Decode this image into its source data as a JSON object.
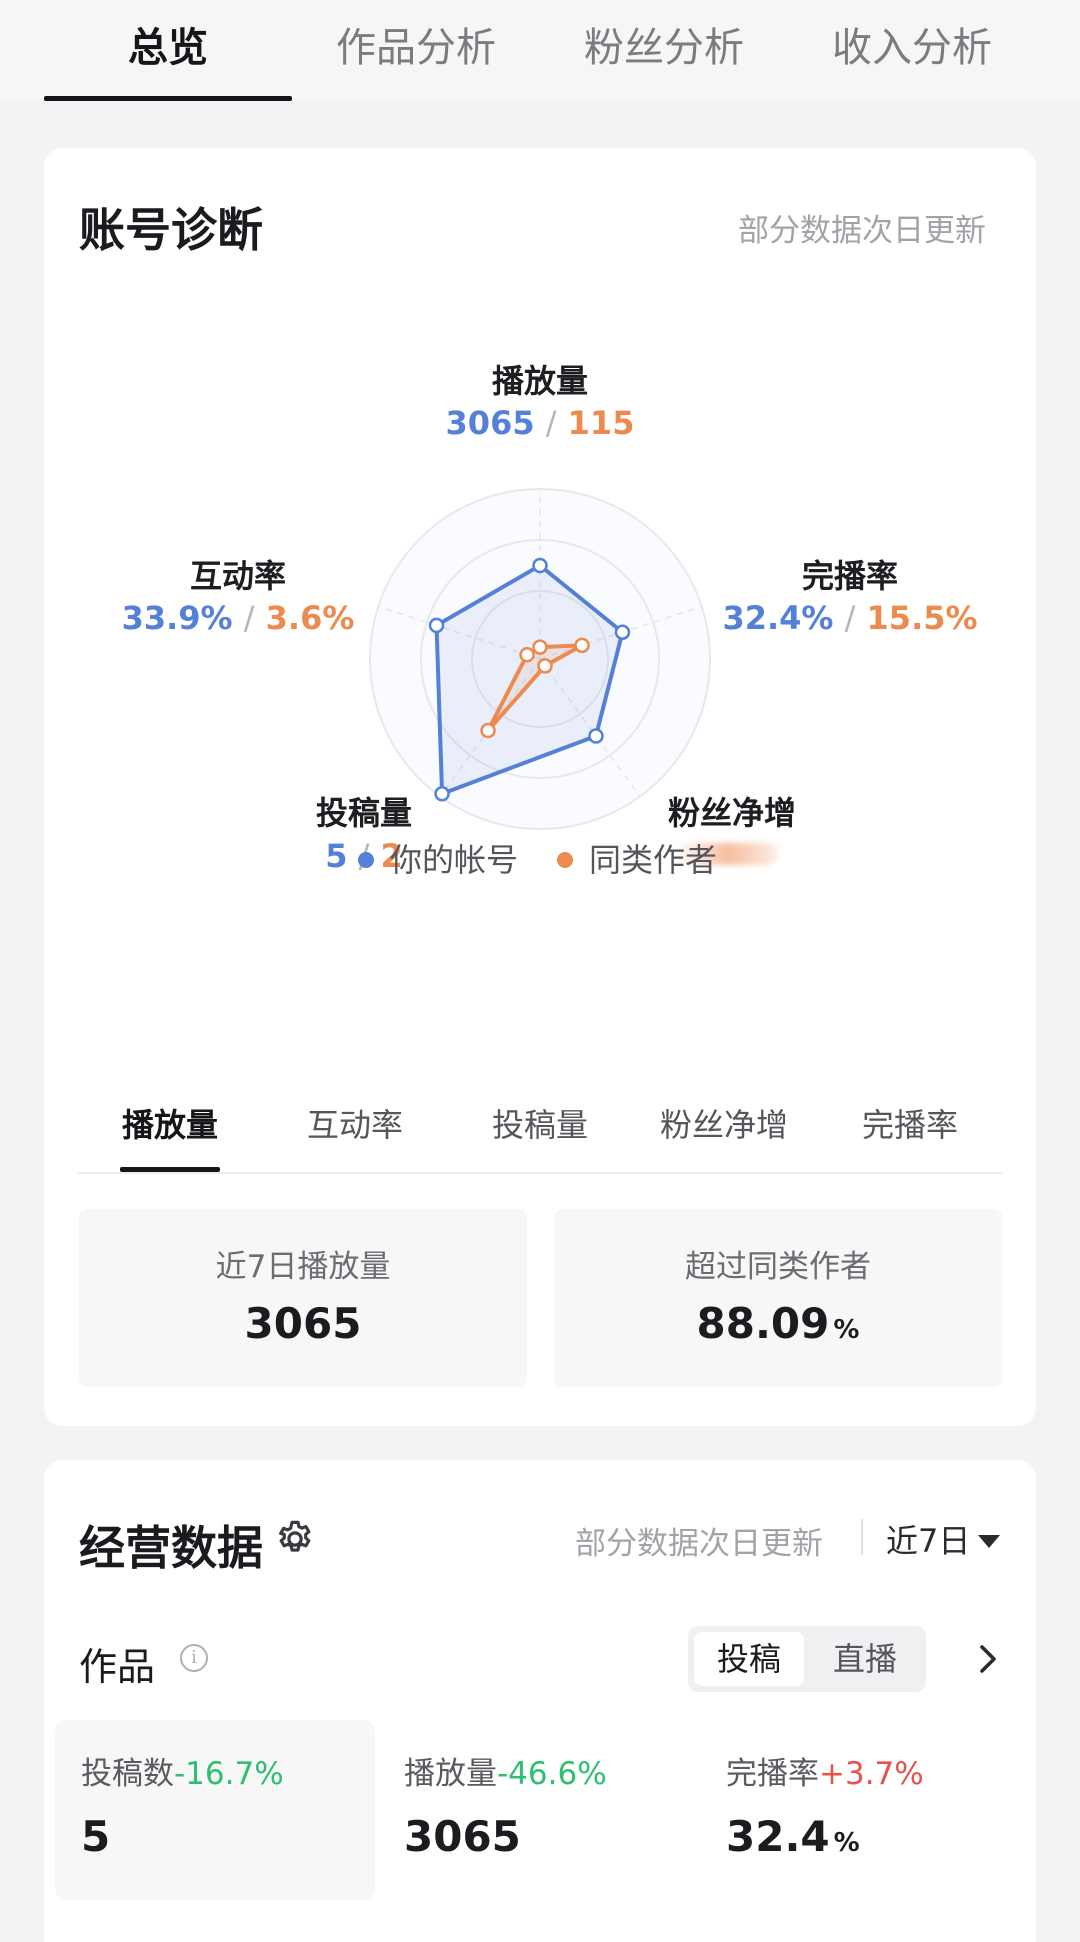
{
  "top_tabs": [
    {
      "label": "总览",
      "active": true
    },
    {
      "label": "作品分析",
      "active": false
    },
    {
      "label": "粉丝分析",
      "active": false
    },
    {
      "label": "收入分析",
      "active": false
    }
  ],
  "diagnosis": {
    "title": "账号诊断",
    "note": "部分数据次日更新",
    "colors": {
      "you": "#5480d8",
      "peer": "#ec8a4f"
    },
    "axes": [
      {
        "label": "播放量",
        "you": "3065",
        "peer": "115"
      },
      {
        "label": "完播率",
        "you": "32.4%",
        "peer": "15.5%"
      },
      {
        "label": "粉丝净增",
        "you": "",
        "peer": "",
        "blurred": true
      },
      {
        "label": "投稿量",
        "you": "5",
        "peer": "2"
      },
      {
        "label": "互动率",
        "you": "33.9%",
        "peer": "3.6%"
      }
    ],
    "separator": "/",
    "legend": [
      {
        "label": "你的帐号",
        "color": "#5480d8"
      },
      {
        "label": "同类作者",
        "color": "#ec8a4f"
      }
    ],
    "metric_tabs": [
      {
        "label": "播放量",
        "active": true
      },
      {
        "label": "互动率",
        "active": false
      },
      {
        "label": "投稿量",
        "active": false
      },
      {
        "label": "粉丝净增",
        "active": false
      },
      {
        "label": "完播率",
        "active": false
      }
    ],
    "stats": [
      {
        "label": "近7日播放量",
        "value": "3065",
        "unit": ""
      },
      {
        "label": "超过同类作者",
        "value": "88.09",
        "unit": "%"
      }
    ]
  },
  "business": {
    "title": "经营数据",
    "settings_icon": "gear-icon",
    "note": "部分数据次日更新",
    "range": "近7日",
    "section": {
      "title": "作品",
      "info_icon": "info-icon",
      "segments": [
        {
          "label": "投稿",
          "active": true
        },
        {
          "label": "直播",
          "active": false
        }
      ],
      "kpis": [
        {
          "label": "投稿数",
          "change": "-16.7%",
          "direction": "down",
          "value": "5",
          "unit": ""
        },
        {
          "label": "播放量",
          "change": "-46.6%",
          "direction": "down",
          "value": "3065",
          "unit": ""
        },
        {
          "label": "完播率",
          "change": "+3.7%",
          "direction": "up",
          "value": "32.4",
          "unit": "%"
        }
      ]
    }
  }
}
